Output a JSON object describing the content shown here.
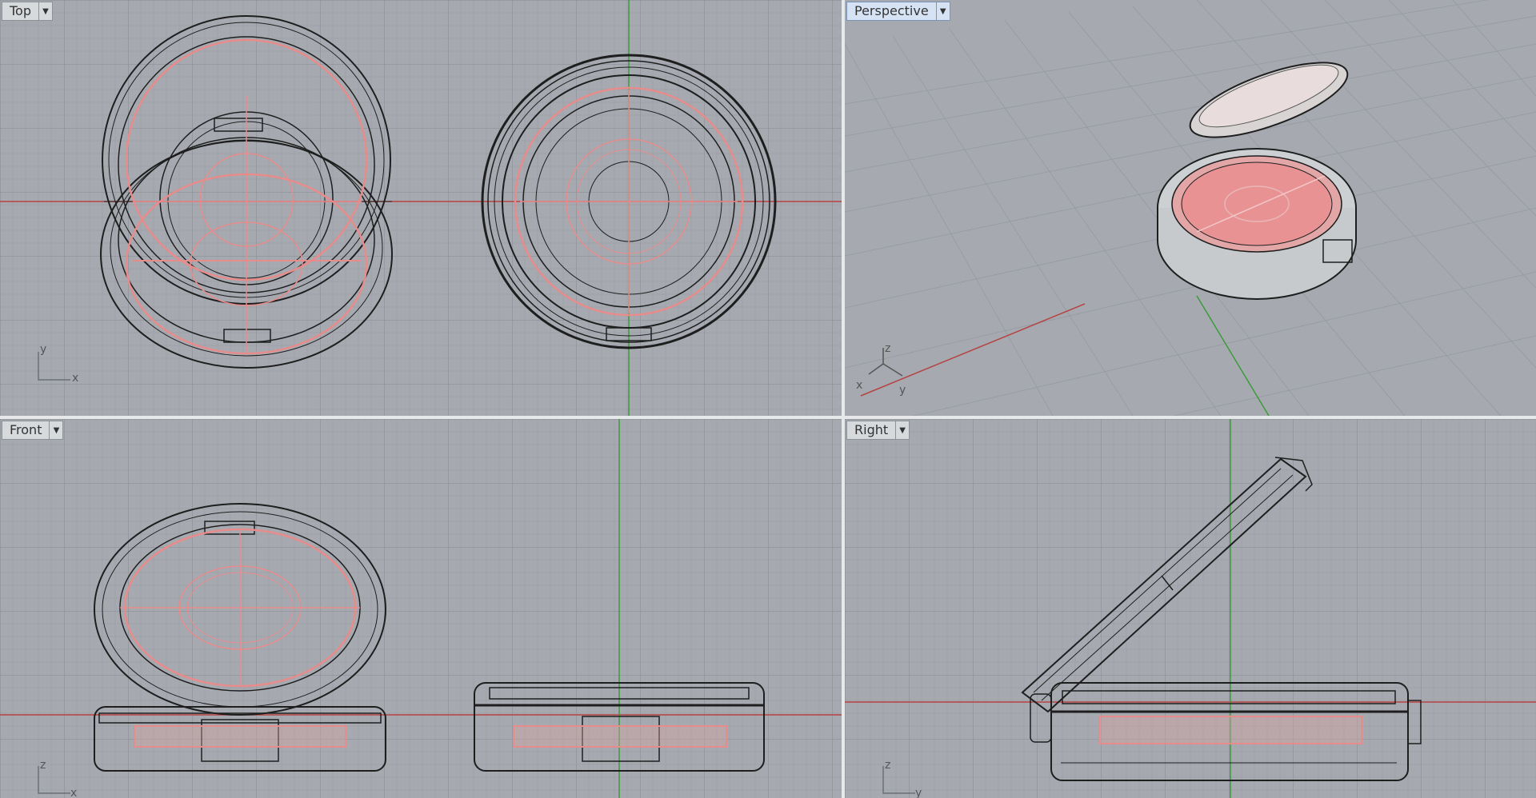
{
  "viewports": [
    {
      "id": "top",
      "label": "Top",
      "active": false,
      "axes": [
        "y",
        "x"
      ]
    },
    {
      "id": "perspective",
      "label": "Perspective",
      "active": true,
      "axes": [
        "z",
        "x",
        "y"
      ]
    },
    {
      "id": "front",
      "label": "Front",
      "active": false,
      "axes": [
        "z",
        "x"
      ]
    },
    {
      "id": "right",
      "label": "Right",
      "active": false,
      "axes": [
        "z",
        "y"
      ]
    }
  ],
  "icons": {
    "viewport_menu": "dropdown-arrow-icon"
  },
  "colors": {
    "background": "#a6aab0",
    "grid_minor": "#9ba0a6",
    "grid_major": "#8b9096",
    "x_axis": "#b54343",
    "y_axis": "#3b9b3b",
    "object_edge": "#1e1e1e",
    "highlight": "#e88b8b"
  }
}
